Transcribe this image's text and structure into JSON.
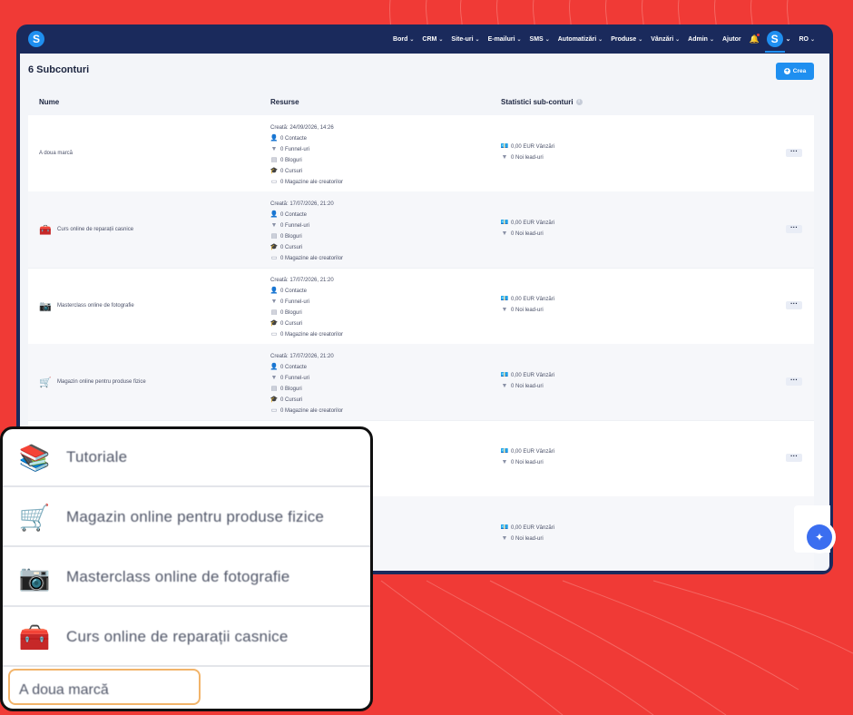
{
  "nav": {
    "items": [
      "Bord",
      "CRM",
      "Site-uri",
      "E-mailuri",
      "SMS",
      "Automatizări",
      "Produse",
      "Vânzări",
      "Admin"
    ],
    "help": "Ajutor",
    "avatar_letter": "S",
    "language": "RO",
    "logo_letter": "S"
  },
  "page": {
    "title": "6 Subconturi",
    "create_label": "Crea"
  },
  "table": {
    "headers": {
      "name": "Nume",
      "resources": "Resurse",
      "stats": "Statistici sub-conturi"
    },
    "rows": [
      {
        "name": "A doua marcă",
        "icon": "",
        "created": "Creată: 24/09/2026, 14:26",
        "contacts": "0 Contacte",
        "funnels": "0 Funnel-uri",
        "blogs": "0 Bloguri",
        "courses": "0 Cursuri",
        "stores": "0 Magazine ale creatorilor",
        "sales": "0,00 EUR Vânzări",
        "leads": "0 Noi lead-uri"
      },
      {
        "name": "Curs online de reparații casnice",
        "icon": "repair-icon",
        "created": "Creată: 17/07/2026, 21:20",
        "contacts": "0 Contacte",
        "funnels": "0 Funnel-uri",
        "blogs": "0 Bloguri",
        "courses": "0 Cursuri",
        "stores": "0 Magazine ale creatorilor",
        "sales": "0,00 EUR Vânzări",
        "leads": "0 Noi lead-uri"
      },
      {
        "name": "Masterclass online de fotografie",
        "icon": "camera-icon",
        "created": "Creată: 17/07/2026, 21:20",
        "contacts": "0 Contacte",
        "funnels": "0 Funnel-uri",
        "blogs": "0 Bloguri",
        "courses": "0 Cursuri",
        "stores": "0 Magazine ale creatorilor",
        "sales": "0,00 EUR Vânzări",
        "leads": "0 Noi lead-uri"
      },
      {
        "name": "Magazin online pentru produse fizice",
        "icon": "cart-icon",
        "created": "Creată: 17/07/2026, 21:20",
        "contacts": "0 Contacte",
        "funnels": "0 Funnel-uri",
        "blogs": "0 Bloguri",
        "courses": "0 Cursuri",
        "stores": "0 Magazine ale creatorilor",
        "sales": "0,00 EUR Vânzări",
        "leads": "0 Noi lead-uri"
      },
      {
        "sales": "0,00 EUR Vânzări",
        "leads": "0 Noi lead-uri"
      },
      {
        "sales": "0,00 EUR Vânzări",
        "leads": "0 Noi lead-uri"
      }
    ]
  },
  "popup": {
    "items": [
      {
        "label": "Tutoriale",
        "icon": "book-icon"
      },
      {
        "label": "Magazin online pentru produse fizice",
        "icon": "cart-icon"
      },
      {
        "label": "Masterclass online de fotografie",
        "icon": "camera-icon"
      },
      {
        "label": "Curs online de reparații casnice",
        "icon": "repair-icon"
      }
    ],
    "selected_label": "A doua marcă",
    "highlight_color": "#f2b46a"
  },
  "colors": {
    "background": "#f03a36",
    "header": "#1a2a5c",
    "accent": "#1f8ff0"
  }
}
